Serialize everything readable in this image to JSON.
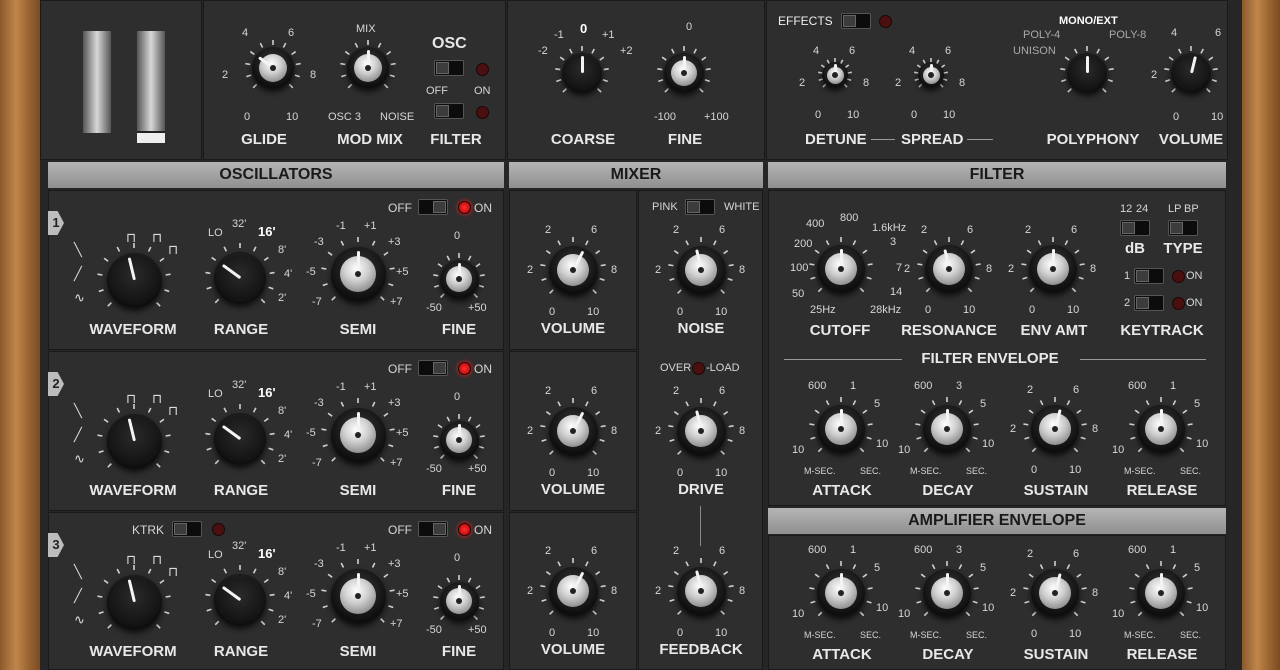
{
  "top": {
    "glide": {
      "label": "GLIDE",
      "ticks": [
        "2",
        "4",
        "6",
        "8",
        "0",
        "10"
      ],
      "value": 0.3
    },
    "mod_mix": {
      "label": "MOD MIX",
      "top": "MIX",
      "left": "OSC 3",
      "right": "NOISE",
      "value": 0.5
    },
    "osc_filter": {
      "osc_label": "OSC",
      "off": "OFF",
      "on": "ON",
      "filter_label": "FILTER"
    },
    "coarse": {
      "label": "COARSE",
      "ticks": [
        "-2",
        "-1",
        "0",
        "+1",
        "+2"
      ]
    },
    "fine": {
      "label": "FINE",
      "ticks": [
        "0",
        "-100",
        "+100"
      ]
    },
    "effects": {
      "label": "EFFECTS"
    },
    "detune": {
      "label": "DETUNE",
      "ticks": [
        "2",
        "4",
        "6",
        "8",
        "0",
        "10"
      ]
    },
    "spread": {
      "label": "SPREAD",
      "ticks": [
        "2",
        "4",
        "6",
        "8",
        "0",
        "10"
      ]
    },
    "polyphony": {
      "label": "POLYPHONY",
      "mono": "MONO/EXT",
      "poly4": "POLY-4",
      "poly8": "POLY-8",
      "unison": "UNISON"
    },
    "volume": {
      "label": "VOLUME",
      "ticks": [
        "2",
        "4",
        "6",
        "8",
        "0",
        "10"
      ]
    }
  },
  "headers": {
    "oscillators": "OSCILLATORS",
    "mixer": "MIXER",
    "filter": "FILTER",
    "filter_env": "FILTER ENVELOPE",
    "amp_env": "AMPLIFIER ENVELOPE"
  },
  "osc": [
    {
      "num": "1",
      "off": "OFF",
      "on": "ON",
      "waveform": "WAVEFORM",
      "range": "RANGE",
      "semi": "SEMI",
      "fine": "FINE",
      "range_ticks": [
        "LO",
        "32'",
        "16'",
        "8'",
        "4'",
        "2'"
      ],
      "semi_ticks": [
        "-3",
        "-1",
        "+1",
        "+3",
        "-5",
        "+5",
        "-7",
        "+7"
      ],
      "fine_ticks": [
        "0",
        "-50",
        "+50"
      ]
    },
    {
      "num": "2",
      "off": "OFF",
      "on": "ON",
      "waveform": "WAVEFORM",
      "range": "RANGE",
      "semi": "SEMI",
      "fine": "FINE",
      "range_ticks": [
        "LO",
        "32'",
        "16'",
        "8'",
        "4'",
        "2'"
      ],
      "semi_ticks": [
        "-3",
        "-1",
        "+1",
        "+3",
        "-5",
        "+5",
        "-7",
        "+7"
      ],
      "fine_ticks": [
        "0",
        "-50",
        "+50"
      ]
    },
    {
      "num": "3",
      "off": "OFF",
      "on": "ON",
      "ktrk": "KTRK",
      "waveform": "WAVEFORM",
      "range": "RANGE",
      "semi": "SEMI",
      "fine": "FINE",
      "range_ticks": [
        "LO",
        "32'",
        "16'",
        "8'",
        "4'",
        "2'"
      ],
      "semi_ticks": [
        "-3",
        "-1",
        "+1",
        "+3",
        "-5",
        "+5",
        "-7",
        "+7"
      ],
      "fine_ticks": [
        "0",
        "-50",
        "+50"
      ]
    }
  ],
  "mixer": {
    "volume": "VOLUME",
    "noise": "NOISE",
    "pink": "PINK",
    "white": "WHITE",
    "drive": "DRIVE",
    "over": "OVER",
    "load": "-LOAD",
    "feedback": "FEEDBACK",
    "ticks": [
      "2",
      "4",
      "6",
      "8",
      "0",
      "10"
    ]
  },
  "filter": {
    "cutoff": "CUTOFF",
    "cutoff_ticks": [
      "400",
      "800",
      "1.6kHz",
      "200",
      "3",
      "100",
      "7",
      "50",
      "14",
      "25Hz",
      "28kHz"
    ],
    "resonance": "RESONANCE",
    "env_amt": "ENV AMT",
    "keytrack": "KEYTRACK",
    "db": "dB",
    "db_opts": [
      "12",
      "24"
    ],
    "type": "TYPE",
    "type_opts": [
      "LP",
      "BP"
    ],
    "kt1": "1",
    "kt2": "2",
    "on": "ON"
  },
  "envelope": {
    "attack": "ATTACK",
    "decay": "DECAY",
    "sustain": "SUSTAIN",
    "release": "RELEASE",
    "time_ticks": [
      "600",
      "1",
      "5",
      "10",
      "10",
      "M-SEC.",
      "SEC."
    ],
    "decay_ticks": [
      "600",
      "3",
      "5",
      "10",
      "10",
      "M-SEC.",
      "SEC."
    ],
    "sustain_ticks": [
      "4",
      "6",
      "2",
      "8",
      "0",
      "10"
    ]
  }
}
